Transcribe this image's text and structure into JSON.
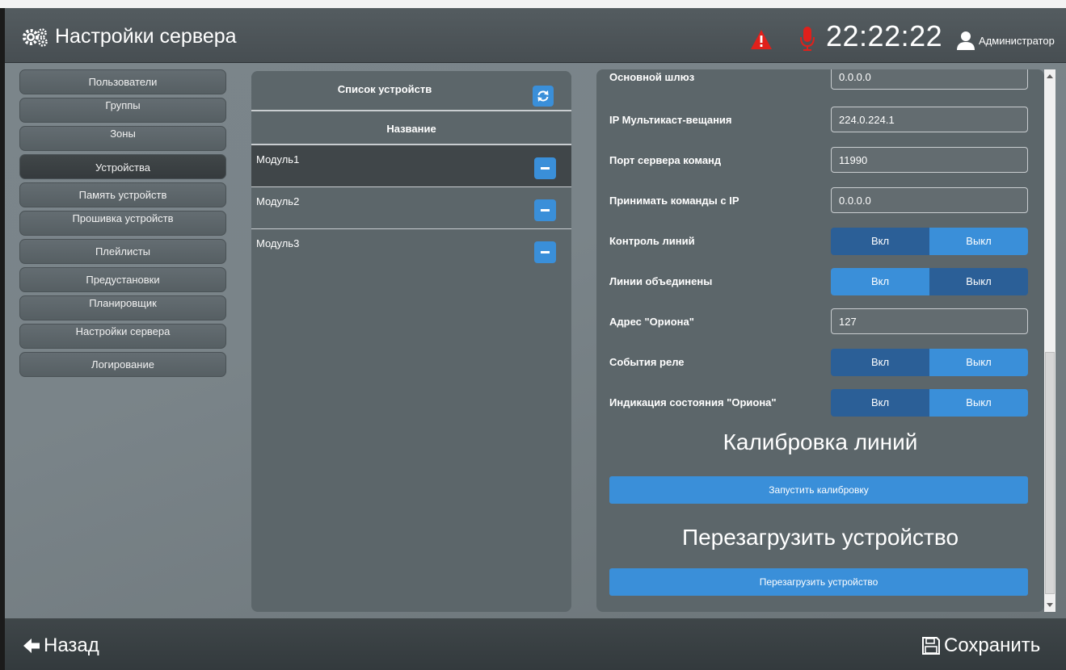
{
  "header": {
    "title": "Настройки сервера",
    "clock": "22:22:22",
    "user": "Администратор"
  },
  "nav": {
    "items": [
      {
        "label": "Пользователи"
      },
      {
        "label": "Группы"
      },
      {
        "label": "Зоны"
      },
      {
        "label": "Устройства",
        "active": true
      },
      {
        "label": "Память устройств"
      },
      {
        "label": "Прошивка устройств"
      },
      {
        "label": "Плейлисты"
      },
      {
        "label": "Предустановки"
      },
      {
        "label": "Планировщик"
      },
      {
        "label": "Настройки сервера"
      },
      {
        "label": "Логирование"
      }
    ]
  },
  "devices": {
    "title": "Список устройств",
    "column": "Название",
    "rows": [
      {
        "name": "Модуль1"
      },
      {
        "name": "Модуль2"
      },
      {
        "name": "Модуль3"
      }
    ]
  },
  "settings": {
    "gateway": {
      "label": "Основной шлюз",
      "value": "0.0.0.0"
    },
    "multicast": {
      "label": "IP Мультикаст-вещания",
      "value": "224.0.224.1"
    },
    "cmd_port": {
      "label": "Порт сервера команд",
      "value": "11990"
    },
    "cmd_ip": {
      "label": "Принимать команды с IP",
      "value": "0.0.0.0"
    },
    "line_control": {
      "label": "Контроль линий",
      "on": "Вкл",
      "off": "Выкл",
      "value": "on"
    },
    "lines_joined": {
      "label": "Линии объединены",
      "on": "Вкл",
      "off": "Выкл",
      "value": "off"
    },
    "orion_addr": {
      "label": "Адрес \"Ориона\"",
      "value": "127"
    },
    "relay_events": {
      "label": "События реле",
      "on": "Вкл",
      "off": "Выкл",
      "value": "on"
    },
    "orion_indication": {
      "label": "Индикация состояния \"Ориона\"",
      "on": "Вкл",
      "off": "Выкл",
      "value": "on"
    },
    "calibration": {
      "heading": "Калибровка линий",
      "button": "Запустить калибровку"
    },
    "reboot": {
      "heading": "Перезагрузить устройство",
      "button": "Перезагрузить устройство"
    }
  },
  "footer": {
    "back": "Назад",
    "save": "Сохранить"
  },
  "icons": {
    "header": "gears-icon",
    "alert": "warning-icon",
    "mic": "microphone-icon",
    "user": "user-icon",
    "refresh": "refresh-icon",
    "remove": "minus-icon",
    "back": "arrow-left-icon",
    "save": "floppy-icon"
  },
  "colors": {
    "accent": "#3a8fd9",
    "accent_dark": "#2b5f97",
    "alert": "#e0201b",
    "panel": "#5c666a"
  }
}
